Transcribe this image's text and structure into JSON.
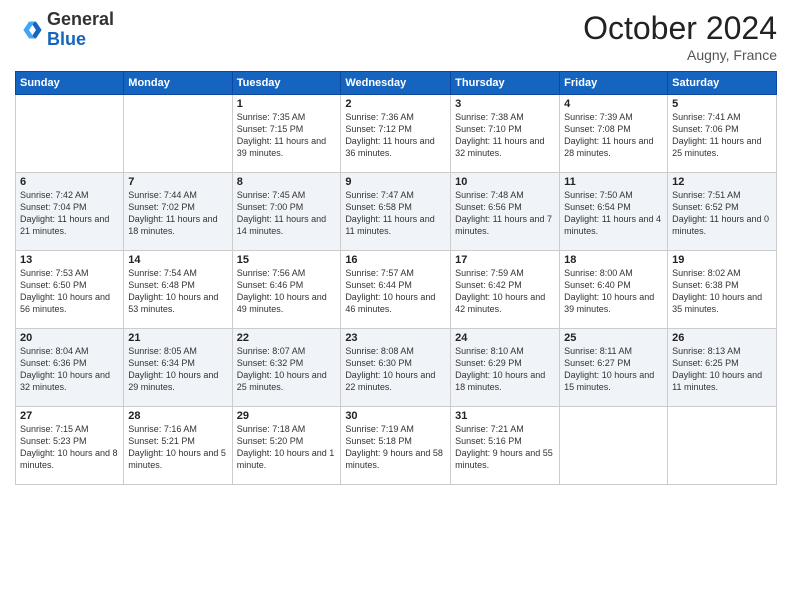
{
  "header": {
    "logo_general": "General",
    "logo_blue": "Blue",
    "month": "October 2024",
    "location": "Augny, France"
  },
  "days_of_week": [
    "Sunday",
    "Monday",
    "Tuesday",
    "Wednesday",
    "Thursday",
    "Friday",
    "Saturday"
  ],
  "weeks": [
    [
      {
        "day": "",
        "info": ""
      },
      {
        "day": "",
        "info": ""
      },
      {
        "day": "1",
        "info": "Sunrise: 7:35 AM\nSunset: 7:15 PM\nDaylight: 11 hours and 39 minutes."
      },
      {
        "day": "2",
        "info": "Sunrise: 7:36 AM\nSunset: 7:12 PM\nDaylight: 11 hours and 36 minutes."
      },
      {
        "day": "3",
        "info": "Sunrise: 7:38 AM\nSunset: 7:10 PM\nDaylight: 11 hours and 32 minutes."
      },
      {
        "day": "4",
        "info": "Sunrise: 7:39 AM\nSunset: 7:08 PM\nDaylight: 11 hours and 28 minutes."
      },
      {
        "day": "5",
        "info": "Sunrise: 7:41 AM\nSunset: 7:06 PM\nDaylight: 11 hours and 25 minutes."
      }
    ],
    [
      {
        "day": "6",
        "info": "Sunrise: 7:42 AM\nSunset: 7:04 PM\nDaylight: 11 hours and 21 minutes."
      },
      {
        "day": "7",
        "info": "Sunrise: 7:44 AM\nSunset: 7:02 PM\nDaylight: 11 hours and 18 minutes."
      },
      {
        "day": "8",
        "info": "Sunrise: 7:45 AM\nSunset: 7:00 PM\nDaylight: 11 hours and 14 minutes."
      },
      {
        "day": "9",
        "info": "Sunrise: 7:47 AM\nSunset: 6:58 PM\nDaylight: 11 hours and 11 minutes."
      },
      {
        "day": "10",
        "info": "Sunrise: 7:48 AM\nSunset: 6:56 PM\nDaylight: 11 hours and 7 minutes."
      },
      {
        "day": "11",
        "info": "Sunrise: 7:50 AM\nSunset: 6:54 PM\nDaylight: 11 hours and 4 minutes."
      },
      {
        "day": "12",
        "info": "Sunrise: 7:51 AM\nSunset: 6:52 PM\nDaylight: 11 hours and 0 minutes."
      }
    ],
    [
      {
        "day": "13",
        "info": "Sunrise: 7:53 AM\nSunset: 6:50 PM\nDaylight: 10 hours and 56 minutes."
      },
      {
        "day": "14",
        "info": "Sunrise: 7:54 AM\nSunset: 6:48 PM\nDaylight: 10 hours and 53 minutes."
      },
      {
        "day": "15",
        "info": "Sunrise: 7:56 AM\nSunset: 6:46 PM\nDaylight: 10 hours and 49 minutes."
      },
      {
        "day": "16",
        "info": "Sunrise: 7:57 AM\nSunset: 6:44 PM\nDaylight: 10 hours and 46 minutes."
      },
      {
        "day": "17",
        "info": "Sunrise: 7:59 AM\nSunset: 6:42 PM\nDaylight: 10 hours and 42 minutes."
      },
      {
        "day": "18",
        "info": "Sunrise: 8:00 AM\nSunset: 6:40 PM\nDaylight: 10 hours and 39 minutes."
      },
      {
        "day": "19",
        "info": "Sunrise: 8:02 AM\nSunset: 6:38 PM\nDaylight: 10 hours and 35 minutes."
      }
    ],
    [
      {
        "day": "20",
        "info": "Sunrise: 8:04 AM\nSunset: 6:36 PM\nDaylight: 10 hours and 32 minutes."
      },
      {
        "day": "21",
        "info": "Sunrise: 8:05 AM\nSunset: 6:34 PM\nDaylight: 10 hours and 29 minutes."
      },
      {
        "day": "22",
        "info": "Sunrise: 8:07 AM\nSunset: 6:32 PM\nDaylight: 10 hours and 25 minutes."
      },
      {
        "day": "23",
        "info": "Sunrise: 8:08 AM\nSunset: 6:30 PM\nDaylight: 10 hours and 22 minutes."
      },
      {
        "day": "24",
        "info": "Sunrise: 8:10 AM\nSunset: 6:29 PM\nDaylight: 10 hours and 18 minutes."
      },
      {
        "day": "25",
        "info": "Sunrise: 8:11 AM\nSunset: 6:27 PM\nDaylight: 10 hours and 15 minutes."
      },
      {
        "day": "26",
        "info": "Sunrise: 8:13 AM\nSunset: 6:25 PM\nDaylight: 10 hours and 11 minutes."
      }
    ],
    [
      {
        "day": "27",
        "info": "Sunrise: 7:15 AM\nSunset: 5:23 PM\nDaylight: 10 hours and 8 minutes."
      },
      {
        "day": "28",
        "info": "Sunrise: 7:16 AM\nSunset: 5:21 PM\nDaylight: 10 hours and 5 minutes."
      },
      {
        "day": "29",
        "info": "Sunrise: 7:18 AM\nSunset: 5:20 PM\nDaylight: 10 hours and 1 minute."
      },
      {
        "day": "30",
        "info": "Sunrise: 7:19 AM\nSunset: 5:18 PM\nDaylight: 9 hours and 58 minutes."
      },
      {
        "day": "31",
        "info": "Sunrise: 7:21 AM\nSunset: 5:16 PM\nDaylight: 9 hours and 55 minutes."
      },
      {
        "day": "",
        "info": ""
      },
      {
        "day": "",
        "info": ""
      }
    ]
  ]
}
